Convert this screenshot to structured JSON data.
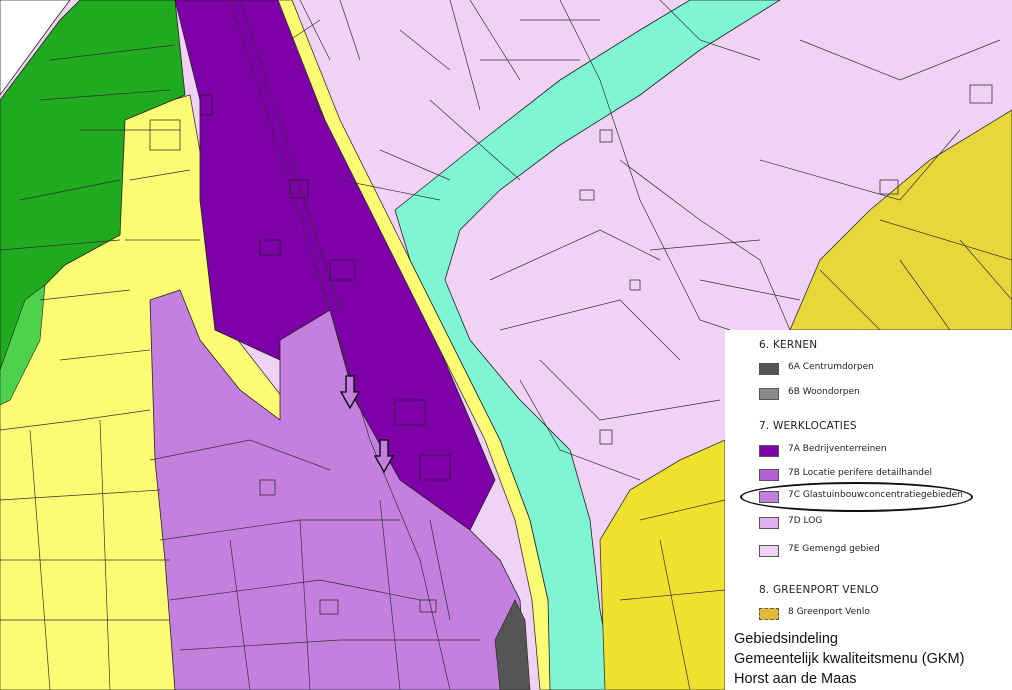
{
  "legend": {
    "sections": [
      {
        "title": "6. KERNEN",
        "items": [
          {
            "label": "6A  Centrumdorpen",
            "color": "#555555"
          },
          {
            "label": "6B  Woondorpen",
            "color": "#8a8a8a"
          }
        ]
      },
      {
        "title": "7. WERKLOCATIES",
        "items": [
          {
            "label": "7A  Bedrijventerreinen",
            "color": "#7d00a8"
          },
          {
            "label": "7B  Locatie perifere detailhandel",
            "color": "#b05fd6"
          },
          {
            "label": "7C  Glastuinbouwconcentratiegebieden",
            "color": "#c57fde",
            "highlighted": true
          },
          {
            "label": "7D  LOG",
            "color": "#e3b0f0"
          },
          {
            "label": "7E  Gemengd gebied",
            "color": "#f0d2f4"
          }
        ]
      },
      {
        "title": "8. GREENPORT VENLO",
        "items": [
          {
            "label": "8  Greenport Venlo",
            "color": "#e2b83a"
          }
        ]
      }
    ]
  },
  "caption": {
    "line1": "Gebiedsindeling",
    "line2": "Gemeentelijk kwaliteitsmenu (GKM)",
    "line3": "Horst aan de Maas"
  },
  "map_colors": {
    "bedrijventerreinen": "#7d00a8",
    "glastuinbouw": "#c57fde",
    "gemengd_gebied": "#f0d2f4",
    "water_zone": "#7ff5d4",
    "rural_yellow": "#fcfc74",
    "greenport": "#e8d63a",
    "green": "#1faa1f",
    "centrumdorp": "#555555"
  },
  "map_marks": [
    {
      "name": "arrow-down-icon"
    },
    {
      "name": "arrow-down-icon"
    }
  ]
}
